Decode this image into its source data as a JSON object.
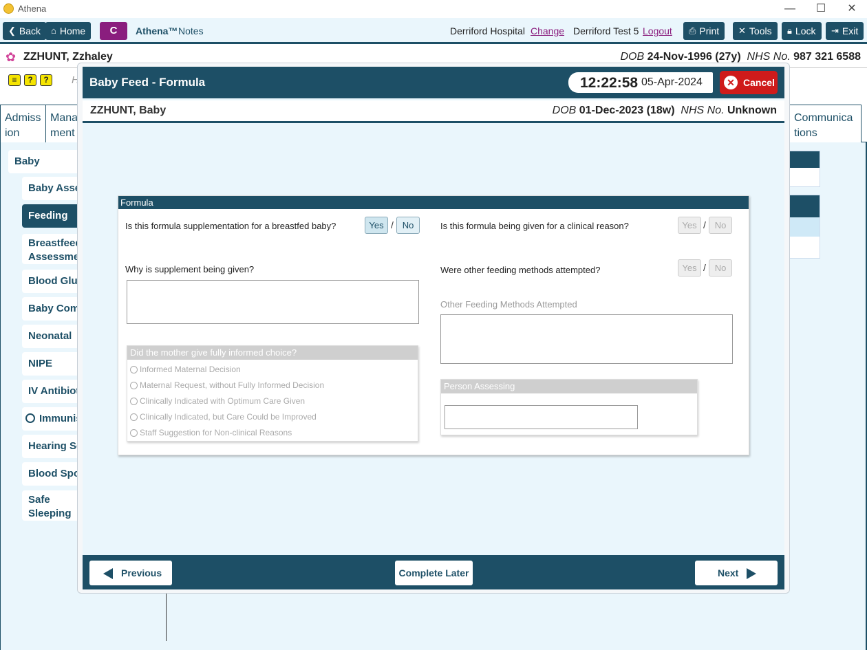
{
  "window": {
    "title": "Athena"
  },
  "toolbar": {
    "back": "Back",
    "home": "Home",
    "c_label": "C",
    "app_name": "Athena™",
    "app_sub": "Notes",
    "hospital": "Derriford Hospital",
    "change": "Change",
    "user": "Derriford Test 5",
    "logout": "Logout",
    "print": "Print",
    "tools": "Tools",
    "lock": "Lock",
    "exit": "Exit"
  },
  "patient": {
    "name": "ZZHUNT, Zzhaley",
    "dob_label": "DOB",
    "dob": "24-Nov-1996 (27y)",
    "nhs_label": "NHS No.",
    "nhs": "987 321 6588"
  },
  "background": {
    "tabs": [
      "Admiss ion",
      "Mana ment",
      "Communica tions"
    ],
    "nav_root": "Baby",
    "nav": [
      "Baby Assess",
      "Feeding",
      "Breastfeeding Assessment",
      "Blood Gluc",
      "Baby Comm",
      "Neonatal",
      "NIPE",
      "IV Antibiot",
      "Immunis",
      "Hearing Sc",
      "Blood Spot",
      "Safe Sleeping Assessment"
    ]
  },
  "modal": {
    "title": "Baby Feed - Formula",
    "time": "12:22:58",
    "date": "05-Apr-2024",
    "cancel": "Cancel",
    "patient_name": "ZZHUNT, Baby",
    "dob_label": "DOB",
    "dob": "01-Dec-2023 (18w)",
    "nhs_label": "NHS No.",
    "nhs": "Unknown",
    "form": {
      "section": "Formula",
      "q1": "Is this formula supplementation for a breastfed baby?",
      "q2": "Is this formula being given for a clinical reason?",
      "q3": "Why is supplement being given?",
      "q4": "Were other feeding methods attempted?",
      "other_methods_label": "Other Feeding Methods Attempted",
      "yes": "Yes",
      "no": "No",
      "slash": "/",
      "choice_header": "Did the mother give fully informed choice?",
      "choices": [
        "Informed Maternal Decision",
        "Maternal Request, without Fully Informed Decision",
        "Clinically Indicated with Optimum Care Given",
        "Clinically Indicated, but Care Could be Improved",
        "Staff Suggestion for Non-clinical Reasons"
      ],
      "person_header": "Person Assessing"
    },
    "footer": {
      "previous": "Previous",
      "complete_later": "Complete Later",
      "next": "Next"
    }
  }
}
